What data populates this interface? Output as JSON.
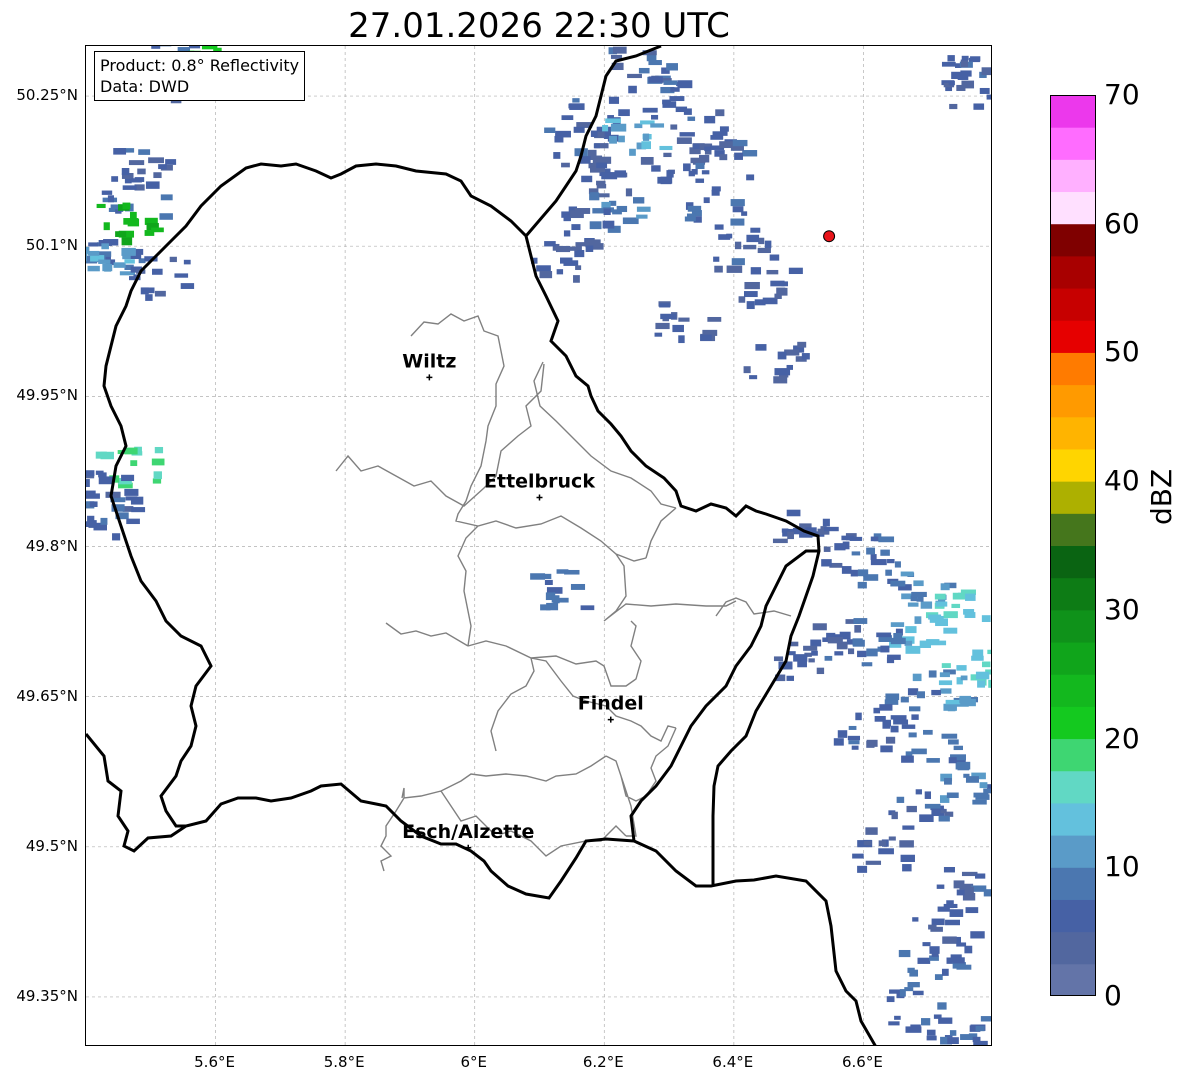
{
  "title": "27.01.2026 22:30 UTC",
  "info": {
    "product": "Product: 0.8° Reflectivity",
    "source": "Data: DWD"
  },
  "map": {
    "lon_range": [
      5.4,
      6.8
    ],
    "lat_range": [
      49.3,
      50.3
    ],
    "lon_ticks": [
      {
        "value": 5.6,
        "label": "5.6°E"
      },
      {
        "value": 5.8,
        "label": "5.8°E"
      },
      {
        "value": 6.0,
        "label": "6°E"
      },
      {
        "value": 6.2,
        "label": "6.2°E"
      },
      {
        "value": 6.4,
        "label": "6.4°E"
      },
      {
        "value": 6.6,
        "label": "6.6°E"
      }
    ],
    "lat_ticks": [
      {
        "value": 50.25,
        "label": "50.25°N"
      },
      {
        "value": 50.1,
        "label": "50.1°N"
      },
      {
        "value": 49.95,
        "label": "49.95°N"
      },
      {
        "value": 49.8,
        "label": "49.8°N"
      },
      {
        "value": 49.65,
        "label": "49.65°N"
      },
      {
        "value": 49.5,
        "label": "49.5°N"
      },
      {
        "value": 49.35,
        "label": "49.35°N"
      }
    ],
    "cities": [
      {
        "name": "Wiltz",
        "lon": 5.93,
        "lat": 49.969
      },
      {
        "name": "Ettelbruck",
        "lon": 6.1,
        "lat": 49.849
      },
      {
        "name": "Findel",
        "lon": 6.21,
        "lat": 49.627
      },
      {
        "name": "Esch/Alzette",
        "lon": 5.99,
        "lat": 49.499
      }
    ],
    "radar_site": {
      "lon": 6.547,
      "lat": 50.11
    },
    "grid": true
  },
  "colorbar": {
    "label": "dBZ",
    "min": 0,
    "max": 70,
    "step": 2.5,
    "ticks": [
      {
        "value": 0,
        "label": "0"
      },
      {
        "value": 10,
        "label": "10"
      },
      {
        "value": 20,
        "label": "20"
      },
      {
        "value": 30,
        "label": "30"
      },
      {
        "value": 40,
        "label": "40"
      },
      {
        "value": 50,
        "label": "50"
      },
      {
        "value": 60,
        "label": "60"
      },
      {
        "value": 70,
        "label": "70"
      }
    ],
    "colors": [
      "#6374a8",
      "#52679f",
      "#4661a5",
      "#4b77b0",
      "#5a9bc8",
      "#63c1dd",
      "#61d8c4",
      "#3ed672",
      "#14c91f",
      "#13b81e",
      "#10a51b",
      "#0f921a",
      "#0d7c15",
      "#0a6412",
      "#45761c",
      "#adb000",
      "#ffd500",
      "#ffb400",
      "#ff9a00",
      "#ff7b00",
      "#e60000",
      "#c70000",
      "#a80000",
      "#7f0000",
      "#ffe0ff",
      "#ffb0ff",
      "#ff6cff",
      "#ec38ec"
    ]
  },
  "echoes": [
    {
      "lon": 5.48,
      "lat": 50.18,
      "dbz": 6
    },
    {
      "lon": 5.47,
      "lat": 50.15,
      "dbz": 7
    },
    {
      "lon": 5.455,
      "lat": 50.125,
      "dbz": 25
    },
    {
      "lon": 5.44,
      "lat": 50.1,
      "dbz": 8
    },
    {
      "lon": 5.42,
      "lat": 50.085,
      "dbz": 12
    },
    {
      "lon": 5.51,
      "lat": 50.07,
      "dbz": 6
    },
    {
      "lon": 5.46,
      "lat": 49.88,
      "dbz": 18
    },
    {
      "lon": 5.43,
      "lat": 49.86,
      "dbz": 6
    },
    {
      "lon": 5.425,
      "lat": 49.83,
      "dbz": 7
    },
    {
      "lon": 5.52,
      "lat": 50.29,
      "dbz": 8
    },
    {
      "lon": 5.58,
      "lat": 50.3,
      "dbz": 22
    },
    {
      "lon": 5.53,
      "lat": 50.27,
      "dbz": 5
    },
    {
      "lon": 6.25,
      "lat": 50.28,
      "dbz": 6
    },
    {
      "lon": 6.27,
      "lat": 50.25,
      "dbz": 7
    },
    {
      "lon": 6.18,
      "lat": 50.23,
      "dbz": 6
    },
    {
      "lon": 6.15,
      "lat": 50.2,
      "dbz": 6
    },
    {
      "lon": 6.24,
      "lat": 50.21,
      "dbz": 13
    },
    {
      "lon": 6.2,
      "lat": 50.17,
      "dbz": 5
    },
    {
      "lon": 6.21,
      "lat": 50.14,
      "dbz": 10
    },
    {
      "lon": 6.17,
      "lat": 50.12,
      "dbz": 6
    },
    {
      "lon": 6.13,
      "lat": 50.09,
      "dbz": 5
    },
    {
      "lon": 6.3,
      "lat": 50.18,
      "dbz": 5
    },
    {
      "lon": 6.34,
      "lat": 50.22,
      "dbz": 6
    },
    {
      "lon": 6.38,
      "lat": 50.19,
      "dbz": 6
    },
    {
      "lon": 6.37,
      "lat": 50.14,
      "dbz": 7
    },
    {
      "lon": 6.41,
      "lat": 50.1,
      "dbz": 6
    },
    {
      "lon": 6.44,
      "lat": 50.06,
      "dbz": 5
    },
    {
      "lon": 6.32,
      "lat": 50.03,
      "dbz": 5
    },
    {
      "lon": 6.46,
      "lat": 49.99,
      "dbz": 5
    },
    {
      "lon": 6.74,
      "lat": 50.28,
      "dbz": 6
    },
    {
      "lon": 6.77,
      "lat": 50.26,
      "dbz": 5
    },
    {
      "lon": 6.13,
      "lat": 49.76,
      "dbz": 8
    },
    {
      "lon": 6.5,
      "lat": 49.82,
      "dbz": 5
    },
    {
      "lon": 6.58,
      "lat": 49.8,
      "dbz": 6
    },
    {
      "lon": 6.62,
      "lat": 49.78,
      "dbz": 8
    },
    {
      "lon": 6.7,
      "lat": 49.76,
      "dbz": 10
    },
    {
      "lon": 6.74,
      "lat": 49.74,
      "dbz": 14
    },
    {
      "lon": 6.68,
      "lat": 49.72,
      "dbz": 13
    },
    {
      "lon": 6.62,
      "lat": 49.7,
      "dbz": 8
    },
    {
      "lon": 6.56,
      "lat": 49.71,
      "dbz": 6
    },
    {
      "lon": 6.5,
      "lat": 49.69,
      "dbz": 5
    },
    {
      "lon": 6.76,
      "lat": 49.68,
      "dbz": 15
    },
    {
      "lon": 6.72,
      "lat": 49.66,
      "dbz": 11
    },
    {
      "lon": 6.66,
      "lat": 49.64,
      "dbz": 7
    },
    {
      "lon": 6.6,
      "lat": 49.62,
      "dbz": 6
    },
    {
      "lon": 6.7,
      "lat": 49.6,
      "dbz": 8
    },
    {
      "lon": 6.76,
      "lat": 49.56,
      "dbz": 9
    },
    {
      "lon": 6.68,
      "lat": 49.54,
      "dbz": 6
    },
    {
      "lon": 6.62,
      "lat": 49.5,
      "dbz": 5
    },
    {
      "lon": 6.74,
      "lat": 49.46,
      "dbz": 6
    },
    {
      "lon": 6.72,
      "lat": 49.42,
      "dbz": 6
    },
    {
      "lon": 6.7,
      "lat": 49.38,
      "dbz": 7
    },
    {
      "lon": 6.68,
      "lat": 49.34,
      "dbz": 7
    },
    {
      "lon": 6.74,
      "lat": 49.32,
      "dbz": 8
    }
  ]
}
